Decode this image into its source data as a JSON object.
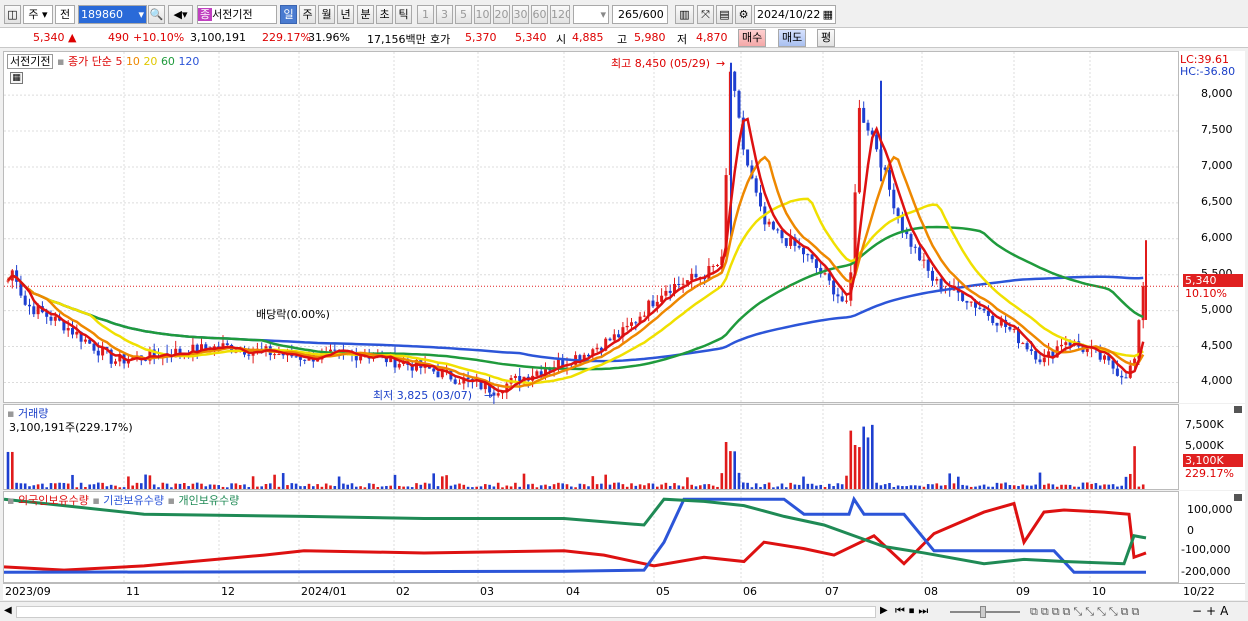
{
  "toolbar": {
    "period_select": "주",
    "mode_select": "전",
    "code": "189860",
    "stock_name": "서전기전",
    "periods": [
      "일",
      "주",
      "월",
      "년",
      "분",
      "초",
      "틱"
    ],
    "minutes": [
      "1",
      "3",
      "5",
      "10",
      "20",
      "30",
      "60",
      "120"
    ],
    "count": "265",
    "count_total": "/600",
    "date": "2024/10/22",
    "badge": "종"
  },
  "quote": {
    "price": "5,340",
    "arrow": "▲",
    "change": "490",
    "change_pct": "+10.10%",
    "volume": "3,100,191",
    "vol_ratio": "229.17%",
    "turnover": "31.96%",
    "amount": "17,156백만",
    "hoga_label": "호가",
    "hoga_ask": "5,370",
    "hoga_bid": "5,340",
    "open_label": "시",
    "open": "4,885",
    "high_label": "고",
    "high": "5,980",
    "low_label": "저",
    "low": "4,870",
    "buy": "매수",
    "sell": "매도",
    "eval": "평"
  },
  "price_pane": {
    "name": "서전기전",
    "legend_prefix": "종가 단순",
    "ma": [
      {
        "label": "5",
        "color": "#dd1111"
      },
      {
        "label": "10",
        "color": "#ee8800"
      },
      {
        "label": "20",
        "color": "#f0e000"
      },
      {
        "label": "60",
        "color": "#1f9a3c"
      },
      {
        "label": "120",
        "color": "#2c55d8"
      }
    ],
    "lc": "LC:39.61",
    "hc": "HC:-36.80",
    "y_ticks": [
      "8,000",
      "7,500",
      "7,000",
      "6,500",
      "6,000",
      "5,500",
      "5,000",
      "4,500",
      "4,000"
    ],
    "cur_price": "5,340",
    "cur_pct": "10.10%",
    "ann_high": "최고 8,450 (05/29)",
    "ann_low": "최저 3,825 (03/07)",
    "ann_div": "배당락(0.00%)"
  },
  "volume_pane": {
    "title": "거래량",
    "info": "3,100,191주(229.17%)",
    "y_ticks": [
      "7,500K",
      "5,000K",
      "2,500K"
    ],
    "cur": "3,100K",
    "cur_pct": "229.17%"
  },
  "holding_pane": {
    "legend": [
      {
        "label": "외국인보유수량",
        "color": "#dd1111"
      },
      {
        "label": "기관보유수량",
        "color": "#2c55d8"
      },
      {
        "label": "개인보유수량",
        "color": "#1f8a55"
      }
    ],
    "y_ticks": [
      "100,000",
      "0",
      "-100,000",
      "-200,000"
    ]
  },
  "x_axis": [
    "2023/09",
    "11",
    "12",
    "2024/01",
    "02",
    "03",
    "04",
    "05",
    "06",
    "07",
    "08",
    "09",
    "10",
    "10/22"
  ],
  "chart_data": {
    "type": "candlestick",
    "title": "서전기전",
    "ylim": [
      3700,
      8600
    ],
    "y_ticks": [
      4000,
      4500,
      5000,
      5500,
      6000,
      6500,
      7000,
      7500,
      8000
    ],
    "annotations": {
      "high": {
        "value": 8450,
        "date": "05/29"
      },
      "low": {
        "value": 3825,
        "date": "03/07"
      }
    },
    "last": {
      "open": 4885,
      "high": 5980,
      "low": 4870,
      "close": 5340,
      "volume": 3100191
    }
  },
  "colors": {
    "up": "#e01b1b",
    "down": "#1e3fd0",
    "grid": "#dcdcdc"
  }
}
